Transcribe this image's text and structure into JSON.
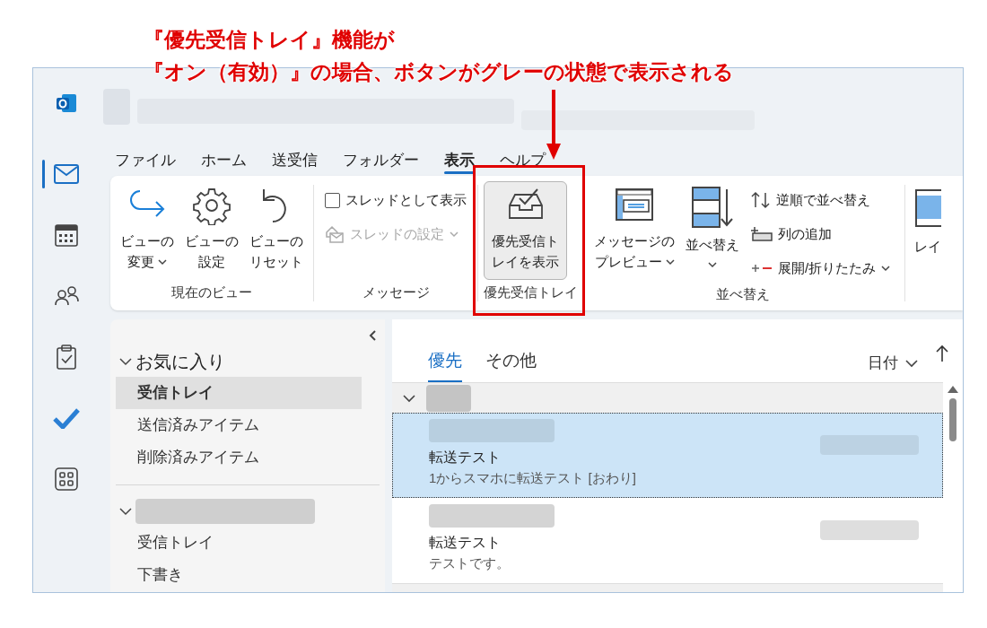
{
  "annotation": {
    "lines": [
      "『優先受信トレイ』機能が",
      "『オン（有効）』の場合、ボタンがグレーの状態で表示される"
    ]
  },
  "rail": [
    {
      "selected": true
    },
    {
      "selected": false
    },
    {
      "selected": false
    },
    {
      "selected": false
    },
    {
      "selected": false
    },
    {
      "selected": false
    }
  ],
  "menu_tabs": [
    {
      "label": "ファイル",
      "selected": false
    },
    {
      "label": "ホーム",
      "selected": false
    },
    {
      "label": "送受信",
      "selected": false
    },
    {
      "label": "フォルダー",
      "selected": false
    },
    {
      "label": "表示",
      "selected": true
    },
    {
      "label": "ヘルプ",
      "selected": false
    }
  ],
  "ribbon": {
    "groups": [
      {
        "label": "現在のビュー",
        "highlighted": false,
        "items": [
          {
            "kind": "large",
            "lines": [
              "ビューの",
              "変更"
            ],
            "dropdown": true
          },
          {
            "kind": "large",
            "lines": [
              "ビューの",
              "設定"
            ],
            "dropdown": false
          },
          {
            "kind": "large",
            "lines": [
              "ビューの",
              "リセット"
            ],
            "dropdown": false
          }
        ]
      },
      {
        "label": "メッセージ",
        "highlighted": false,
        "items": [
          {
            "kind": "check",
            "label": "スレッドとして表示",
            "checked": false
          },
          {
            "kind": "small",
            "label": "スレッドの設定",
            "disabled": true,
            "dropdown": true
          }
        ]
      },
      {
        "label": "優先受信トレイ",
        "highlighted": true,
        "items": [
          {
            "kind": "large",
            "lines": [
              "優先受信ト",
              "レイを表示"
            ],
            "dropdown": false,
            "pressed": true
          }
        ]
      },
      {
        "label": "並べ替え",
        "highlighted": false,
        "items": [
          {
            "kind": "large",
            "lines": [
              "メッセージの",
              "プレビュー"
            ],
            "dropdown": true
          },
          {
            "kind": "large",
            "lines": [
              "並べ替え"
            ],
            "dropdown": true
          },
          {
            "kind": "small",
            "label": "逆順で並べ替え",
            "disabled": false,
            "dropdown": false
          },
          {
            "kind": "small",
            "label": "列の追加",
            "disabled": false,
            "dropdown": false
          },
          {
            "kind": "small",
            "label": "展開/折りたたみ",
            "disabled": false,
            "dropdown": true
          }
        ]
      }
    ],
    "cut_label": "レイ"
  },
  "folders": [
    {
      "label": "お気に入り",
      "expanded": true,
      "children": [
        {
          "label": "受信トレイ",
          "selected": true
        },
        {
          "label": "送信済みアイテム",
          "selected": false
        },
        {
          "label": "削除済みアイテム",
          "selected": false
        }
      ]
    },
    {
      "expanded": true,
      "children": [
        {
          "label": "受信トレイ",
          "selected": false
        },
        {
          "label": "下書き",
          "selected": false
        }
      ]
    }
  ],
  "mail_list": {
    "tabs": [
      {
        "label": "優先",
        "selected": true
      },
      {
        "label": "その他",
        "selected": false
      }
    ],
    "sort": {
      "label": "日付"
    },
    "group": {
      "expanded": true
    },
    "messages": [
      {
        "subject": "転送テスト",
        "preview": "1からスマホに転送テスト [おわり]",
        "selected": true
      },
      {
        "subject": "転送テスト",
        "preview": "テストです。",
        "selected": false
      }
    ]
  }
}
